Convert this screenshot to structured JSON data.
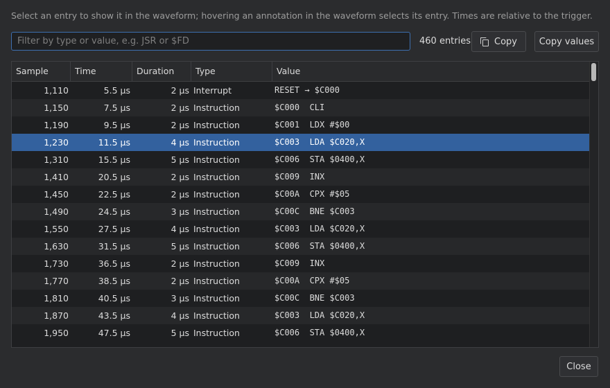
{
  "hint": "Select an entry to show it in the waveform; hovering an annotation in the waveform selects its entry. Times are relative to the trigger.",
  "filter": {
    "value": "",
    "placeholder": "Filter by type or value, e.g. JSR or $FD"
  },
  "entry_count": "460 entries",
  "buttons": {
    "copy": "Copy",
    "copy_values": "Copy values",
    "close": "Close"
  },
  "columns": {
    "sample": "Sample",
    "time": "Time",
    "duration": "Duration",
    "type": "Type",
    "value": "Value"
  },
  "selected_row_index": 3,
  "rows": [
    {
      "sample": "1,110",
      "time": "5.5 µs",
      "duration": "2 µs",
      "type": "Interrupt",
      "value": "RESET → $C000"
    },
    {
      "sample": "1,150",
      "time": "7.5 µs",
      "duration": "2 µs",
      "type": "Instruction",
      "value": "$C000  CLI"
    },
    {
      "sample": "1,190",
      "time": "9.5 µs",
      "duration": "2 µs",
      "type": "Instruction",
      "value": "$C001  LDX #$00"
    },
    {
      "sample": "1,230",
      "time": "11.5 µs",
      "duration": "4 µs",
      "type": "Instruction",
      "value": "$C003  LDA $C020,X"
    },
    {
      "sample": "1,310",
      "time": "15.5 µs",
      "duration": "5 µs",
      "type": "Instruction",
      "value": "$C006  STA $0400,X"
    },
    {
      "sample": "1,410",
      "time": "20.5 µs",
      "duration": "2 µs",
      "type": "Instruction",
      "value": "$C009  INX"
    },
    {
      "sample": "1,450",
      "time": "22.5 µs",
      "duration": "2 µs",
      "type": "Instruction",
      "value": "$C00A  CPX #$05"
    },
    {
      "sample": "1,490",
      "time": "24.5 µs",
      "duration": "3 µs",
      "type": "Instruction",
      "value": "$C00C  BNE $C003"
    },
    {
      "sample": "1,550",
      "time": "27.5 µs",
      "duration": "4 µs",
      "type": "Instruction",
      "value": "$C003  LDA $C020,X"
    },
    {
      "sample": "1,630",
      "time": "31.5 µs",
      "duration": "5 µs",
      "type": "Instruction",
      "value": "$C006  STA $0400,X"
    },
    {
      "sample": "1,730",
      "time": "36.5 µs",
      "duration": "2 µs",
      "type": "Instruction",
      "value": "$C009  INX"
    },
    {
      "sample": "1,770",
      "time": "38.5 µs",
      "duration": "2 µs",
      "type": "Instruction",
      "value": "$C00A  CPX #$05"
    },
    {
      "sample": "1,810",
      "time": "40.5 µs",
      "duration": "3 µs",
      "type": "Instruction",
      "value": "$C00C  BNE $C003"
    },
    {
      "sample": "1,870",
      "time": "43.5 µs",
      "duration": "4 µs",
      "type": "Instruction",
      "value": "$C003  LDA $C020,X"
    },
    {
      "sample": "1,950",
      "time": "47.5 µs",
      "duration": "5 µs",
      "type": "Instruction",
      "value": "$C006  STA $0400,X"
    }
  ],
  "colors": {
    "accent": "#33619e",
    "background": "#2b2c2e",
    "table_background": "#1e1f21"
  },
  "icons": {
    "copy": "copy-icon"
  }
}
